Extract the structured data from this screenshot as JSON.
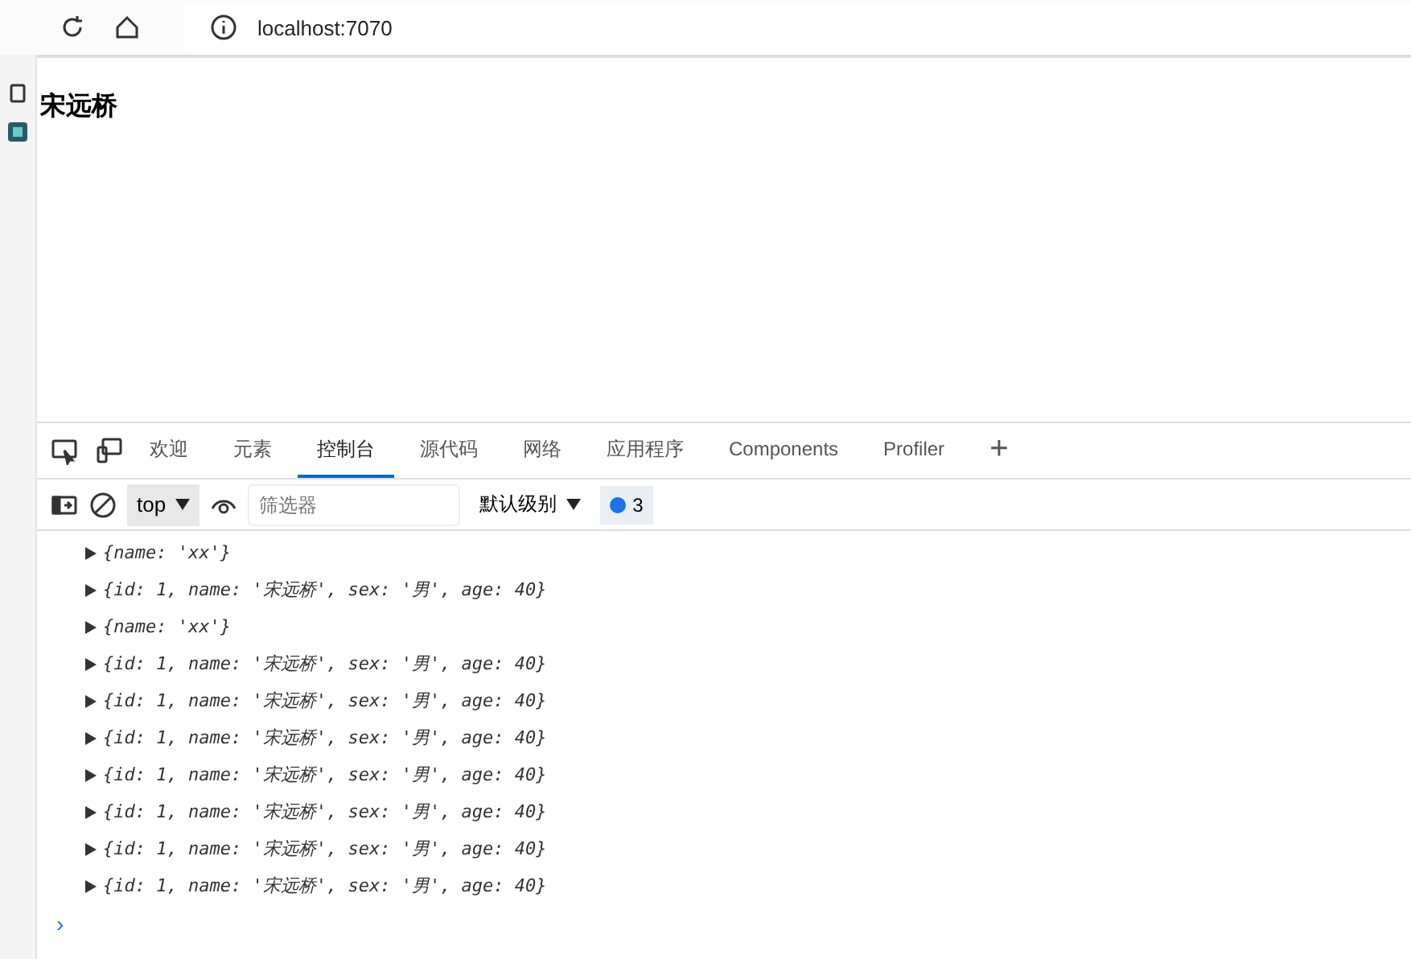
{
  "browser": {
    "url": "localhost:7070"
  },
  "page": {
    "heading": "宋远桥"
  },
  "devtools": {
    "tabs": [
      {
        "label": "欢迎",
        "selected": false
      },
      {
        "label": "元素",
        "selected": false
      },
      {
        "label": "控制台",
        "selected": true
      },
      {
        "label": "源代码",
        "selected": false
      },
      {
        "label": "网络",
        "selected": false
      },
      {
        "label": "应用程序",
        "selected": false
      },
      {
        "label": "Components",
        "selected": false
      },
      {
        "label": "Profiler",
        "selected": false
      }
    ],
    "add_tab": "+",
    "toolbar": {
      "context": "top",
      "filter": {
        "placeholder": "筛选器"
      },
      "level": "默认级别",
      "message_count": "3"
    },
    "console": {
      "entries": [
        "{name: 'xx'}",
        "{id: 1, name: '宋远桥', sex: '男', age: 40}",
        "{name: 'xx'}",
        "{id: 1, name: '宋远桥', sex: '男', age: 40}",
        "{id: 1, name: '宋远桥', sex: '男', age: 40}",
        "{id: 1, name: '宋远桥', sex: '男', age: 40}",
        "{id: 1, name: '宋远桥', sex: '男', age: 40}",
        "{id: 1, name: '宋远桥', sex: '男', age: 40}",
        "{id: 1, name: '宋远桥', sex: '男', age: 40}",
        "{id: 1, name: '宋远桥', sex: '男', age: 40}"
      ],
      "prompt": "›"
    }
  }
}
